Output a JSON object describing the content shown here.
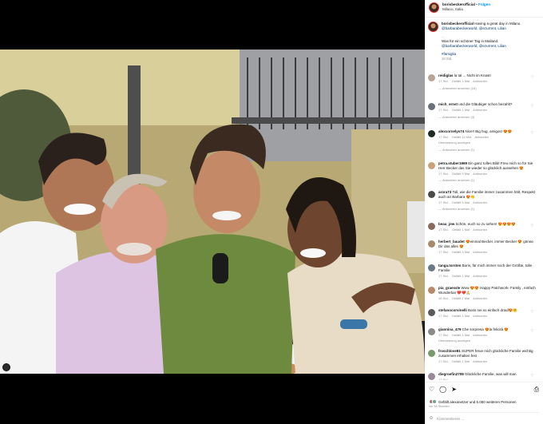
{
  "post": {
    "username": "borisbeckerofficial",
    "separator": "•",
    "follow_label": "Folgen",
    "location": "Milano, Italia"
  },
  "caption": {
    "username": "borisbeckerofficial",
    "text": "Having a great day in Milano.",
    "mentions": "@barbarabeckerworld, @ezurrent, Lilian",
    "text2": "Was für ein schöner Tag in Mailand.",
    "mentions2": "@barbarabeckerworld, @ezurrent, Lilian",
    "hashtag": "#famiglia",
    "time": "18 Std."
  },
  "comments": [
    {
      "user": "reidiglas",
      "text": "la tal ... Nicht im Knast!",
      "time": "17 Std.",
      "likes": "Gefällt 1 Mal",
      "reply": "Antworten",
      "thread": "Antworten ansehen (16)",
      "color": "#b9a394"
    },
    {
      "user": "mich_ernst",
      "text": "und die Gläubiger schon bezahlt?",
      "time": "17 Std.",
      "likes": "Gefällt 1 Mal",
      "reply": "Antworten",
      "thread": "Antworten ansehen (3)",
      "color": "#6b6f7a"
    },
    {
      "user": "alexcornelys74",
      "text": "Nice!! Big hug, amigos! 😍😍",
      "time": "17 Std.",
      "likes": "Gefällt 12 Mal",
      "reply": "Antworten",
      "extra": "Übersetzung anzeigen",
      "thread": "Antworten ansehen (1)",
      "color": "#1e2a22"
    },
    {
      "user": "petra.stuber1969",
      "text": "Ein ganz tolles Bild! Freu mich so für Sie Herr Becker das Sie wieder so glücklich aussehen 😍",
      "time": "17 Std.",
      "likes": "Gefällt 9 Mal",
      "reply": "Antworten",
      "thread": "Antworten ansehen (1)",
      "color": "#c9a27a"
    },
    {
      "user": "arora73",
      "text": "Toll, wie die Familie immer zusammen hält, Respekt auch an Barbara 😍👏",
      "time": "17 Std.",
      "likes": "Gefällt 5 Mal",
      "reply": "Antworten",
      "thread": "Antworten ansehen (1)",
      "color": "#4a4a4a"
    },
    {
      "user": "beau_jew",
      "text": "Schön, euch so zu sehen! 😍😍😍😍",
      "time": "17 Std.",
      "likes": "Gefällt 1 Mal",
      "reply": "Antworten",
      "color": "#8a6a5a"
    },
    {
      "user": "herbert_baudet",
      "text": "😍einmal Becker, immer Becker 😍 gönne Dir das alles 😍",
      "time": "17 Std.",
      "likes": "Gefällt 3 Mal",
      "reply": "Antworten",
      "color": "#a88a6a"
    },
    {
      "user": "tanga.torsten",
      "text": "Boris, für mich immer noch der Größte, tolle Familie",
      "time": "17 Std.",
      "likes": "Gefällt 1 Mal",
      "reply": "Antworten",
      "color": "#6a7a8a"
    },
    {
      "user": "pia_graessle",
      "text": "Wow 😍😍 Happy Patchwork- Family , einfach Wunderbar ❤️❤️🙏",
      "time": "16 Std.",
      "likes": "Gefällt 2 Mal",
      "reply": "Antworten",
      "color": "#b88a6a"
    },
    {
      "user": "stefanocorvinelli",
      "text": "Boris nei so einfach drauf😍🤗",
      "time": "17 Std.",
      "likes": "Gefällt 1 Mal",
      "reply": "Antworten",
      "color": "#5a5a5a"
    },
    {
      "user": "giannina_479",
      "text": "Che sorpresa 😍la felicità 😍",
      "time": "17 Std.",
      "likes": "Gefällt 1 Mal",
      "reply": "Antworten",
      "extra": "Übersetzung anzeigen",
      "color": "#8a8a8a"
    },
    {
      "user": "froschlove81",
      "text": "SUPER freue mich glückliche Familie wichtig zusammen erhalten fest",
      "time": "17 Std.",
      "likes": "Gefällt 1 Mal",
      "reply": "Antworten",
      "color": "#7a9a6a"
    },
    {
      "user": "diegroefin2708",
      "text": "Glückliche Familie, was will man",
      "time": "17 Std.",
      "likes": "",
      "reply": "",
      "color": "#9a8a9a"
    }
  ],
  "actions": {
    "likes_text": "Gefällt alexanetzer und 5.050 weiteren Personen",
    "date": "vor 18 Stunden",
    "add_placeholder": "Kommentieren ..."
  },
  "icons": [
    "heart-icon",
    "comment-icon",
    "share-icon",
    "bookmark-icon",
    "emoji-icon"
  ]
}
